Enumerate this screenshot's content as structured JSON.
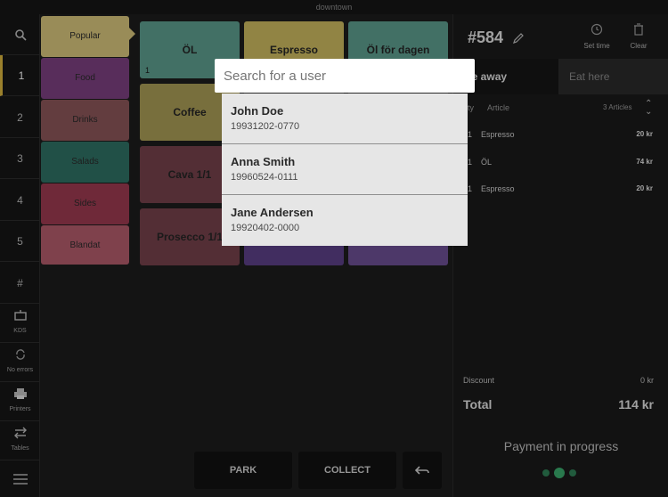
{
  "window": {
    "title": "downtown"
  },
  "rail": {
    "items": [
      {
        "label": "1"
      },
      {
        "label": "2"
      },
      {
        "label": "3"
      },
      {
        "label": "4"
      },
      {
        "label": "5"
      },
      {
        "label": "#"
      }
    ],
    "kds": "KDS",
    "errors": "No errors",
    "printer": "Printers",
    "tables": "Tables"
  },
  "categories": [
    {
      "label": "Popular",
      "color": "#d4c27a"
    },
    {
      "label": "Food",
      "color": "#7b3f7f"
    },
    {
      "label": "Drinks",
      "color": "#8a5558"
    },
    {
      "label": "Salads",
      "color": "#2f6f63"
    },
    {
      "label": "Sides",
      "color": "#9a3a4f"
    },
    {
      "label": "Blandat",
      "color": "#b05a6a"
    }
  ],
  "products": [
    {
      "label": "ÖL",
      "color": "#5c9c8d",
      "count": "1"
    },
    {
      "label": "Espresso",
      "color": "#c9b85f"
    },
    {
      "label": "Öl för dagen",
      "color": "#5c9c8d"
    },
    {
      "label": "Coffee",
      "color": "#a79a55"
    },
    {
      "label": "Cava 1/1",
      "color": "#74404a"
    },
    {
      "label": "Prosecco 1/1",
      "color": "#74404a"
    }
  ],
  "order": {
    "number": "#584",
    "set_time": "Set time",
    "clear": "Clear",
    "take_away": "ke away",
    "eat_here": "Eat here",
    "col_qty": "ty",
    "col_article": "Article",
    "articles_count": "3 Articles",
    "lines": [
      {
        "qty": "1",
        "name": "Espresso",
        "price": "20 kr"
      },
      {
        "qty": "1",
        "name": "ÖL",
        "price": "74 kr"
      },
      {
        "qty": "1",
        "name": "Espresso",
        "price": "20 kr"
      }
    ],
    "discount_label": "Discount",
    "discount_value": "0 kr",
    "total_label": "Total",
    "total_value": "114 kr",
    "payment_status": "Payment in progress"
  },
  "actions": {
    "park": "PARK",
    "collect": "COLLECT"
  },
  "search": {
    "placeholder": "Search for a user"
  },
  "users": [
    {
      "name": "John Doe",
      "id": "19931202-0770"
    },
    {
      "name": "Anna Smith",
      "id": "19960524-0111"
    },
    {
      "name": "Jane Andersen",
      "id": "19920402-0000"
    }
  ]
}
